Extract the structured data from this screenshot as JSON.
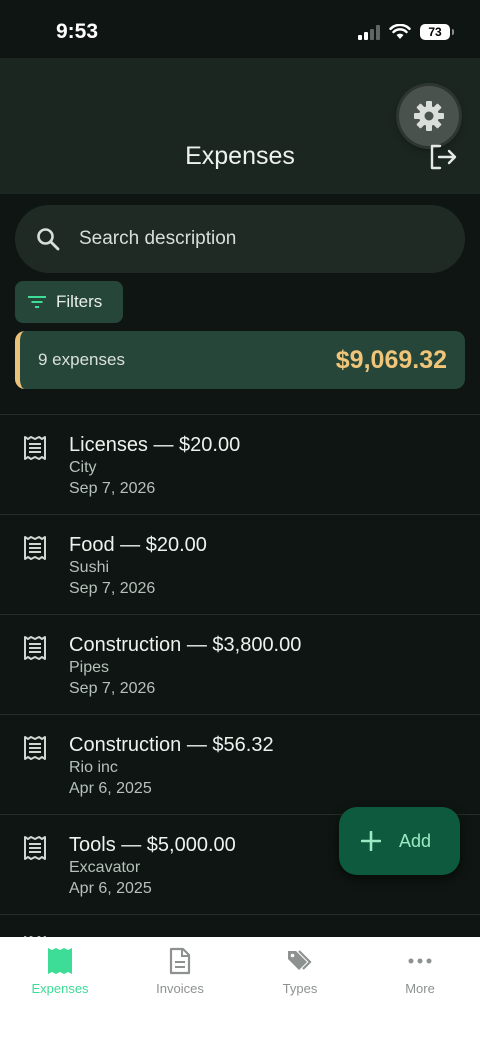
{
  "status_bar": {
    "time": "9:53",
    "battery": "73"
  },
  "header": {
    "title": "Expenses"
  },
  "search": {
    "placeholder": "Search description"
  },
  "filters": {
    "label": "Filters"
  },
  "summary": {
    "count": "9 expenses",
    "total": "$9,069.32"
  },
  "expenses": [
    {
      "title": "Licenses — $20.00",
      "subtitle": "City",
      "date": "Sep 7, 2026"
    },
    {
      "title": "Food — $20.00",
      "subtitle": "Sushi",
      "date": "Sep 7, 2026"
    },
    {
      "title": "Construction — $3,800.00",
      "subtitle": "Pipes",
      "date": "Sep 7, 2026"
    },
    {
      "title": "Construction — $56.32",
      "subtitle": "Rio inc",
      "date": "Apr 6, 2025"
    },
    {
      "title": "Tools — $5,000.00",
      "subtitle": "Excavator",
      "date": "Apr 6, 2025"
    }
  ],
  "fab": {
    "label": "Add"
  },
  "nav": {
    "items": [
      {
        "label": "Expenses",
        "icon": "receipt-icon"
      },
      {
        "label": "Invoices",
        "icon": "document-icon"
      },
      {
        "label": "Types",
        "icon": "tags-icon"
      },
      {
        "label": "More",
        "icon": "more-icon"
      }
    ]
  },
  "colors": {
    "background": "#0e1512",
    "accent": "#3ddc97",
    "total": "#f0c57a",
    "summary_bg": "#27463a",
    "fab_bg": "#0e5a3e"
  }
}
